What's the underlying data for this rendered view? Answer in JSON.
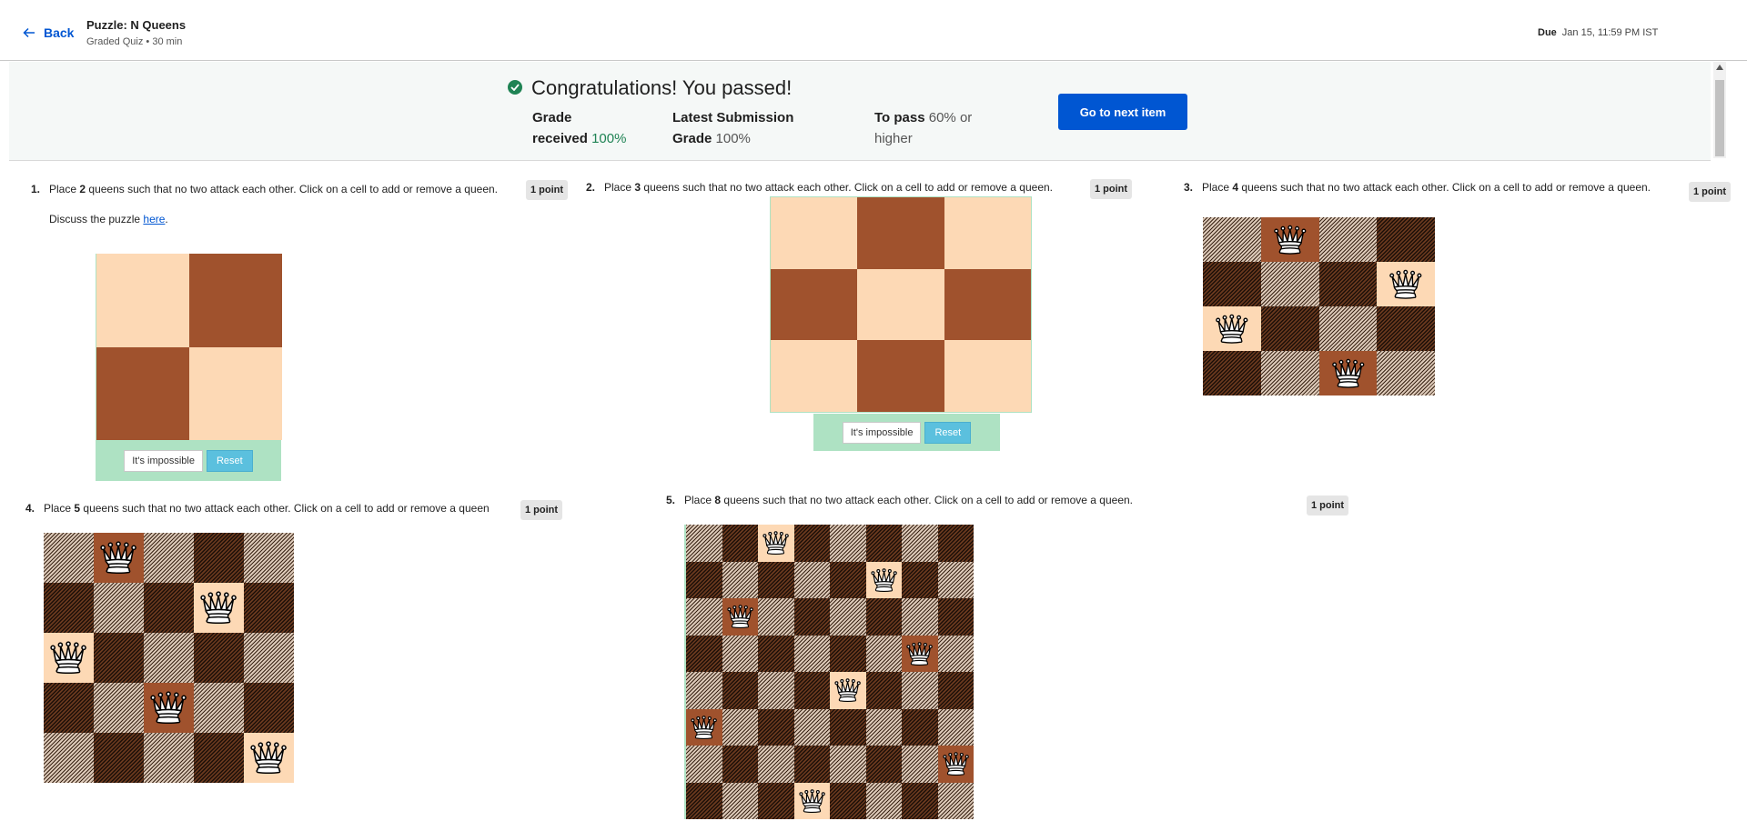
{
  "header": {
    "back_label": "Back",
    "title": "Puzzle: N Queens",
    "subtitle": "Graded Quiz • 30 min",
    "due_label": "Due",
    "due_value": "Jan 15, 11:59 PM IST"
  },
  "banner": {
    "message": "Congratulations! You passed!",
    "grade_label_1": "Grade",
    "grade_label_2": "received",
    "grade_value": "100%",
    "latest_label": "Latest Submission",
    "latest_grade_label": "Grade",
    "latest_grade_value": "100%",
    "pass_label": "To pass",
    "pass_value_1": "60% or",
    "pass_value_2": "higher",
    "next_button": "Go to next item"
  },
  "questions": [
    {
      "number": "1.",
      "prefix": "Place ",
      "n": "2",
      "suffix": " queens such that no two attack each other. Click on a cell to add or remove a queen.",
      "points": "1 point",
      "discuss_prefix": "Discuss the puzzle ",
      "discuss_link": "here",
      "discuss_suffix": ".",
      "size": 2,
      "queens": [],
      "impossible_label": "It's impossible",
      "reset_label": "Reset"
    },
    {
      "number": "2.",
      "prefix": "Place ",
      "n": "3",
      "suffix": " queens such that no two attack each other. Click on a cell to add or remove a queen.",
      "points": "1 point",
      "size": 3,
      "queens": [],
      "impossible_label": "It's impossible",
      "reset_label": "Reset"
    },
    {
      "number": "3.",
      "prefix": "Place ",
      "n": "4",
      "suffix": " queens such that no two attack each other. Click on a cell to add or remove a queen.",
      "points": "1 point",
      "size": 4,
      "queens": [
        [
          0,
          1
        ],
        [
          1,
          3
        ],
        [
          2,
          0
        ],
        [
          3,
          2
        ]
      ]
    },
    {
      "number": "4.",
      "prefix": "Place ",
      "n": "5",
      "suffix": " queens such that no two attack each other. Click on a cell to add or remove a queen",
      "points": "1 point",
      "size": 5,
      "queens": [
        [
          0,
          1
        ],
        [
          1,
          3
        ],
        [
          2,
          0
        ],
        [
          3,
          2
        ],
        [
          4,
          4
        ]
      ]
    },
    {
      "number": "5.",
      "prefix": "Place ",
      "n": "8",
      "suffix": " queens such that no two attack each other. Click on a cell to add or remove a queen.",
      "points": "1 point",
      "size": 8,
      "queens": [
        [
          0,
          2
        ],
        [
          1,
          5
        ],
        [
          2,
          1
        ],
        [
          3,
          6
        ],
        [
          4,
          4
        ],
        [
          5,
          0
        ],
        [
          6,
          7
        ],
        [
          7,
          3
        ]
      ]
    }
  ],
  "colors": {
    "accent": "#0056d2",
    "success": "#1f8354",
    "light_square": "#fdd9b5",
    "dark_square": "#a0522d",
    "controls_bg": "#aee2c3",
    "reset_button": "#5bc0de"
  },
  "icons": {
    "back": "arrow-left-icon",
    "passed": "check-circle-icon",
    "queen": "queen-icon"
  }
}
